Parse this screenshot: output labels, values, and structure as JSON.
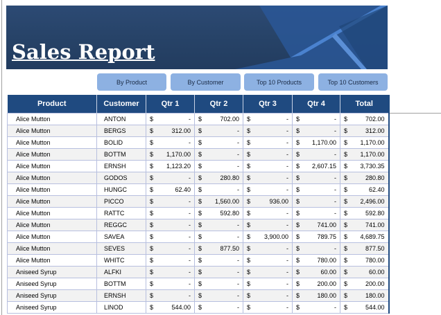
{
  "header": {
    "title": "Sales Report"
  },
  "buttons": [
    {
      "label": "By Product"
    },
    {
      "label": "By Customer"
    },
    {
      "label": "Top 10 Products"
    },
    {
      "label": "Top 10 Customers"
    }
  ],
  "columns": [
    "Product",
    "Customer",
    "Qtr 1",
    "Qtr 2",
    "Qtr 3",
    "Qtr 4",
    "Total"
  ],
  "currency_symbol": "$",
  "rows": [
    [
      "Alice Mutton",
      "ANTON",
      "-",
      "702.00",
      "-",
      "-",
      "702.00"
    ],
    [
      "Alice Mutton",
      "BERGS",
      "312.00",
      "-",
      "-",
      "-",
      "312.00"
    ],
    [
      "Alice Mutton",
      "BOLID",
      "-",
      "-",
      "-",
      "1,170.00",
      "1,170.00"
    ],
    [
      "Alice Mutton",
      "BOTTM",
      "1,170.00",
      "-",
      "-",
      "-",
      "1,170.00"
    ],
    [
      "Alice Mutton",
      "ERNSH",
      "1,123.20",
      "-",
      "-",
      "2,607.15",
      "3,730.35"
    ],
    [
      "Alice Mutton",
      "GODOS",
      "-",
      "280.80",
      "-",
      "-",
      "280.80"
    ],
    [
      "Alice Mutton",
      "HUNGC",
      "62.40",
      "-",
      "-",
      "-",
      "62.40"
    ],
    [
      "Alice Mutton",
      "PICCO",
      "-",
      "1,560.00",
      "936.00",
      "-",
      "2,496.00"
    ],
    [
      "Alice Mutton",
      "RATTC",
      "-",
      "592.80",
      "-",
      "-",
      "592.80"
    ],
    [
      "Alice Mutton",
      "REGGC",
      "-",
      "-",
      "-",
      "741.00",
      "741.00"
    ],
    [
      "Alice Mutton",
      "SAVEA",
      "-",
      "-",
      "3,900.00",
      "789.75",
      "4,689.75"
    ],
    [
      "Alice Mutton",
      "SEVES",
      "-",
      "877.50",
      "-",
      "-",
      "877.50"
    ],
    [
      "Alice Mutton",
      "WHITC",
      "-",
      "-",
      "-",
      "780.00",
      "780.00"
    ],
    [
      "Aniseed Syrup",
      "ALFKI",
      "-",
      "-",
      "-",
      "60.00",
      "60.00"
    ],
    [
      "Aniseed Syrup",
      "BOTTM",
      "-",
      "-",
      "-",
      "200.00",
      "200.00"
    ],
    [
      "Aniseed Syrup",
      "ERNSH",
      "-",
      "-",
      "-",
      "180.00",
      "180.00"
    ],
    [
      "Aniseed Syrup",
      "LINOD",
      "544.00",
      "-",
      "-",
      "-",
      "544.00"
    ]
  ]
}
